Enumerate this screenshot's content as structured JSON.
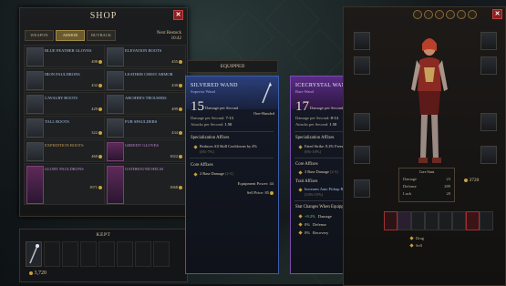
{
  "shop": {
    "title": "SHOP",
    "tabs": [
      {
        "label": "WEAPON",
        "active": false
      },
      {
        "label": "ARMOR",
        "active": true
      },
      {
        "label": "BUYBACK",
        "active": false
      }
    ],
    "restock_label": "Next Restock",
    "restock_time": "10:42",
    "items": [
      {
        "name": "BLUE FEATHER GLOVES",
        "price": "498",
        "rarity": "rare"
      },
      {
        "name": "ELEVATION BOOTS",
        "price": "455",
        "rarity": "rare"
      },
      {
        "name": "IRON PAULDRONS",
        "price": "432",
        "rarity": "rare"
      },
      {
        "name": "LEATHER CHEST ARMOR",
        "price": "430",
        "rarity": "rare"
      },
      {
        "name": "CAVALRY BOOTS",
        "price": "429",
        "rarity": "rare"
      },
      {
        "name": "ARCHER'S TROUSERS",
        "price": "499",
        "rarity": "rare"
      },
      {
        "name": "TALL BOOTS",
        "price": "322",
        "rarity": "rare"
      },
      {
        "name": "FUR SPAULDERS",
        "price": "434",
        "rarity": "rare"
      },
      {
        "name": "EXPEDITION BOOTS",
        "price": "460",
        "rarity": "legendary"
      },
      {
        "name": "GREEDY GLOVES",
        "price": "1022",
        "rarity": "epic"
      },
      {
        "name": "GLORY PAULDRONS",
        "price": "1071",
        "rarity": "epic"
      },
      {
        "name": "OATHBOUND HELM",
        "price": "1068",
        "rarity": "epic"
      }
    ]
  },
  "kept": {
    "title": "KEPT",
    "gold": "3,720"
  },
  "equipped": {
    "header": "EQUIPPED",
    "current": {
      "name": "SILVERED WAND",
      "rarity": "Superior Wand",
      "damage": "15",
      "damage_label": "Damage per Second",
      "hand": "One-Handed",
      "dmg_per_sec_label": "Damage per Second:",
      "dmg_per_sec": "7-13",
      "attacks_label": "Attacks per Second:",
      "attacks": "1.50",
      "spec_title": "Specialization Affixes",
      "spec_affix": "Reduces All Skill Cooldowns by 4%",
      "spec_range": "[4%-7%]",
      "core_title": "Core Affixes",
      "core_affix": "2 Base Damage",
      "core_range": "[2-3]",
      "power_label": "Equipment Power:",
      "power": "44",
      "sell_label": "Sell Price:",
      "sell_price": "85"
    },
    "compare": {
      "name": "ICECRYSTAL WAND",
      "rarity": "Rare Wand",
      "damage": "17",
      "damage_label": "Damage per Second",
      "hand": "One-Handed",
      "dmg_per_sec_label": "Damage per Second:",
      "dmg_per_sec": "8-14",
      "attacks_label": "Attacks per Second:",
      "attacks": "1.50",
      "spec_title": "Specialization Affixes",
      "spec_affix": "Fated Strike: 8.2% Freeze Chance",
      "spec_range": "[6%-10%]",
      "core_title": "Core Affixes",
      "core_affix": "3 Base Damage",
      "core_range": "[2-3]",
      "trait_title": "Trait Affixes",
      "trait_affix": "Increases Auto Pickup Range by 13%",
      "trait_range": "[10%-15%]",
      "changes_title": "Stat Changes When Equipped:",
      "changes": [
        {
          "value": "+9.2%",
          "label": "Damage",
          "positive": true
        },
        {
          "value": "0%",
          "label": "Defense",
          "positive": false
        },
        {
          "value": "0%",
          "label": "Recovery",
          "positive": false
        }
      ],
      "power_label": "Equipment Power:",
      "power": "54",
      "sell_label": "Sell Price:",
      "sell_price": "99"
    }
  },
  "character": {
    "stats_title": "Core Stats",
    "stats": [
      {
        "label": "Damage",
        "value": "23"
      },
      {
        "label": "Defense",
        "value": "289"
      },
      {
        "label": "Luck",
        "value": "20"
      }
    ],
    "gold": "3720",
    "legend": [
      {
        "label": "Drag"
      },
      {
        "label": "Sell"
      }
    ]
  },
  "colors": {
    "rare": "#aac4ee",
    "epic": "#c28ad6",
    "legendary": "#c9a35a",
    "gold": "#c9a13b",
    "positive": "#79d07a"
  }
}
